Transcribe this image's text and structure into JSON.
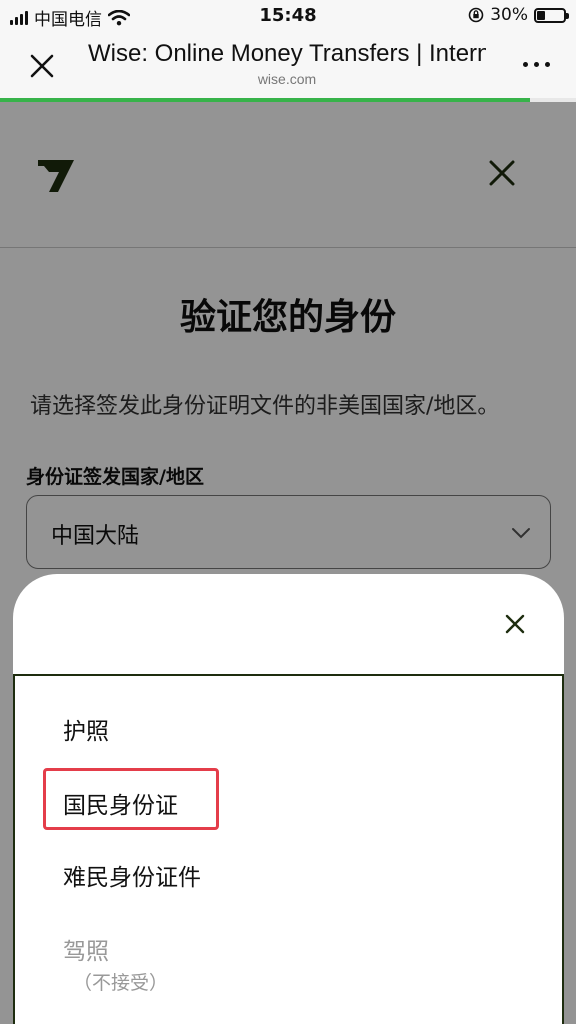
{
  "status_bar": {
    "carrier": "中国电信",
    "time": "15:48",
    "battery": "30%",
    "battery_level": 0.3
  },
  "browser": {
    "title": "Wise: Online Money Transfers | International Banking Features",
    "url": "wise.com",
    "load_progress": 0.92
  },
  "page": {
    "title": "验证您的身份",
    "description": "请选择签发此身份证明文件的非美国国家/地区。",
    "field_label": "身份证签发国家/地区",
    "country_value": "中国大陆"
  },
  "sheet": {
    "options": [
      {
        "label": "护照"
      },
      {
        "label": "国民身份证"
      },
      {
        "label": "难民身份证件"
      },
      {
        "label": "驾照",
        "note": "（不接受）"
      }
    ]
  },
  "colors": {
    "brand_dark": "#1e2d0f",
    "progress": "#37b34a",
    "highlight": "#e43d4a"
  }
}
